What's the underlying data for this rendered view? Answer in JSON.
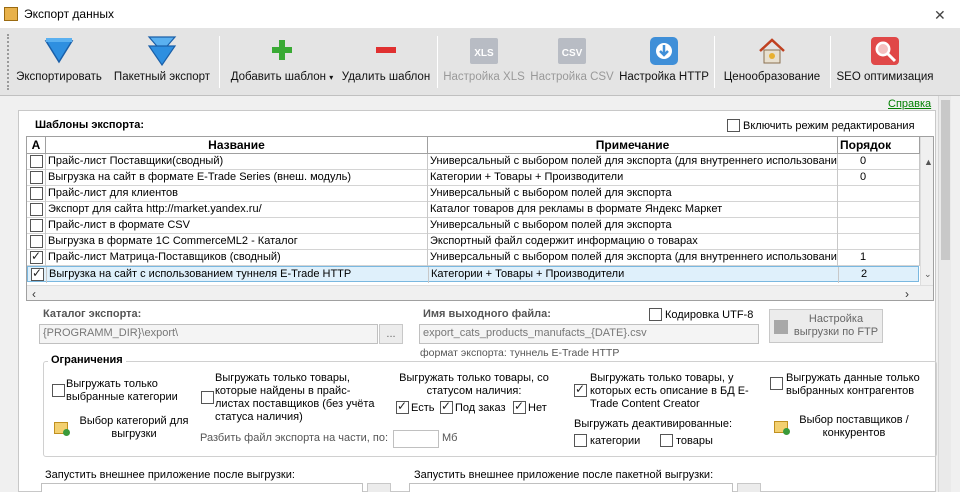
{
  "window": {
    "title": "Экспорт данных"
  },
  "toolbar": {
    "items": [
      {
        "label": "Экспортировать",
        "icon": "export-arrow-icon"
      },
      {
        "label": "Пакетный экспорт",
        "icon": "batch-export-icon"
      },
      {
        "label": "Добавить шаблон",
        "icon": "plus-icon"
      },
      {
        "label": "Удалить шаблон",
        "icon": "minus-icon"
      },
      {
        "label": "Настройка XLS",
        "icon": "xls-icon",
        "disabled": true,
        "badge": "XLS"
      },
      {
        "label": "Настройка CSV",
        "icon": "csv-icon",
        "disabled": true,
        "badge": "CSV"
      },
      {
        "label": "Настройка HTTP",
        "icon": "http-icon"
      },
      {
        "label": "Ценообразование",
        "icon": "pricing-house-icon"
      },
      {
        "label": "SEO оптимизация",
        "icon": "seo-magnifier-icon"
      }
    ]
  },
  "help": {
    "label": "Справка"
  },
  "templates": {
    "title": "Шаблоны экспорта:",
    "edit_mode_label": "Включить режим редактирования",
    "columns": {
      "a": "A",
      "name": "Название",
      "note": "Примечание",
      "order": "Порядок"
    },
    "rows": [
      {
        "checked": false,
        "name": "Прайс-лист Поставщики(сводный)",
        "note": "Универсальный с выбором полей для экспорта (для внутреннего использования)",
        "order": "0"
      },
      {
        "checked": false,
        "name": "Выгрузка на сайт в формате E-Trade Series (внеш. модуль)",
        "note": "Категории + Товары + Производители",
        "order": "0"
      },
      {
        "checked": false,
        "name": "Прайс-лист для клиентов",
        "note": "Универсальный с выбором полей для экспорта",
        "order": ""
      },
      {
        "checked": false,
        "name": "Экспорт для сайта http://market.yandex.ru/",
        "note": "Каталог товаров для рекламы в формате Яндекс Маркет",
        "order": ""
      },
      {
        "checked": false,
        "name": "Прайс-лист в формате CSV",
        "note": "Универсальный с выбором полей для экспорта",
        "order": ""
      },
      {
        "checked": false,
        "name": "Выгрузка в формате 1C CommerceML2 - Каталог",
        "note": "Экспортный файл содержит информацию о товарах",
        "order": ""
      },
      {
        "checked": true,
        "name": "Прайс-лист Матрица-Поставщиков (сводный)",
        "note": "Универсальный с выбором полей для экспорта (для внутреннего использования)",
        "order": "1"
      },
      {
        "checked": true,
        "name": "Выгрузка на сайт с использованием туннеля E-Trade HTTP",
        "note": "Категории + Товары + Производители",
        "order": "2",
        "selected": true
      }
    ]
  },
  "export_dir": {
    "label": "Каталог экспорта:",
    "value": "{PROGRAMM_DIR}\\export\\",
    "browse": "..."
  },
  "output_file": {
    "label": "Имя выходного файла:",
    "value": "export_cats_products_manufacts_{DATE}.csv",
    "format_note": "формат экспорта: туннель E-Trade HTTP"
  },
  "utf8": {
    "label": "Кодировка UTF-8",
    "checked": false
  },
  "ftp_button": {
    "label": "Настройка выгрузки по FTP"
  },
  "limits": {
    "title": "Ограничения",
    "only_selected_categories": {
      "label": "Выгружать только выбранные категории",
      "checked": false
    },
    "select_categories": {
      "label": "Выбор категорий для выгрузки"
    },
    "only_found_in_price": {
      "label": "Выгружать только товары, которые найдены в прайс-листах поставщиков (без учёта статуса наличия)",
      "checked": false
    },
    "split_file": {
      "label": "Разбить файл экспорта на части, по:",
      "unit": "Мб",
      "value": ""
    },
    "status": {
      "label": "Выгружать только товары, со статусом наличия:",
      "options": [
        {
          "label": "Есть",
          "checked": true
        },
        {
          "label": "Под заказ",
          "checked": true
        },
        {
          "label": "Нет",
          "checked": true
        }
      ]
    },
    "with_description": {
      "label": "Выгружать только товары, у которых есть описание в БД E-Trade Content Creator",
      "checked": true
    },
    "deactivated": {
      "label": "Выгружать деактивированные:",
      "options": [
        {
          "label": "категории",
          "checked": false
        },
        {
          "label": "товары",
          "checked": false
        }
      ]
    },
    "only_selected_contractors": {
      "label": "Выгружать данные только выбранных контрагентов",
      "checked": false
    },
    "select_suppliers": {
      "label": "Выбор поставщиков / конкурентов"
    }
  },
  "run_after_export": {
    "label": "Запустить внешнее приложение после выгрузки:"
  },
  "run_after_batch": {
    "label": "Запустить внешнее приложение после пакетной выгрузки:"
  }
}
